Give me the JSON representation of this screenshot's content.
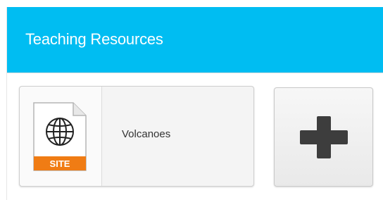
{
  "header": {
    "title": "Teaching Resources"
  },
  "resources": [
    {
      "label": "Volcanoes",
      "icon": "globe-icon",
      "file_badge": "SITE"
    }
  ],
  "add_button": {
    "icon": "plus-icon"
  },
  "colors": {
    "header_bg": "#00bdf2",
    "badge_bg": "#f07c14",
    "plus": "#3d3d3d"
  }
}
